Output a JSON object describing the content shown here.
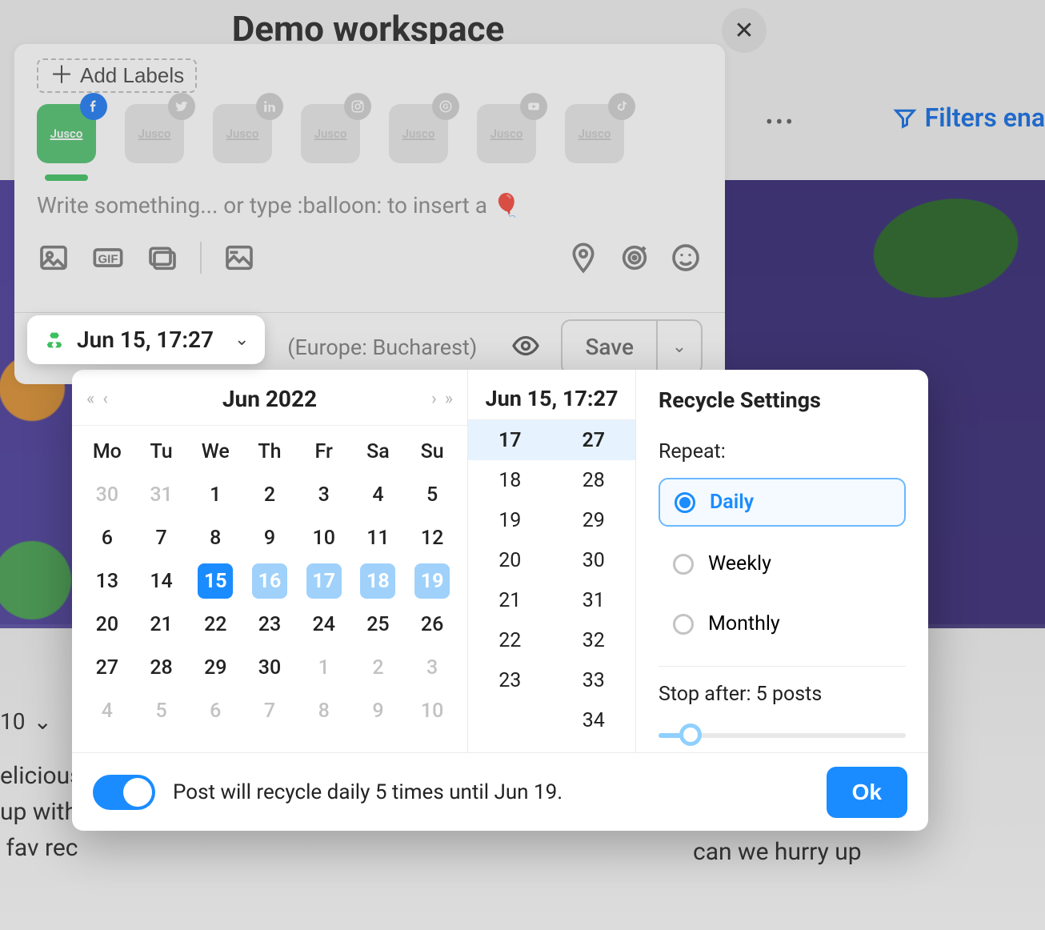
{
  "workspace": {
    "title": "Demo workspace"
  },
  "topbar": {
    "filters_label": "Filters ena"
  },
  "composer": {
    "add_labels": "Add Labels",
    "accounts": [
      {
        "brand": "Jusco",
        "network": "facebook",
        "active": true,
        "badge_color": "#1877f2"
      },
      {
        "brand": "Jusco",
        "network": "twitter",
        "active": false
      },
      {
        "brand": "Jusco",
        "network": "linkedin",
        "active": false
      },
      {
        "brand": "Jusco",
        "network": "instagram",
        "active": false
      },
      {
        "brand": "Jusco",
        "network": "google",
        "active": false
      },
      {
        "brand": "Jusco",
        "network": "youtube",
        "active": false
      },
      {
        "brand": "Jusco",
        "network": "tiktok",
        "active": false
      }
    ],
    "placeholder": "Write something... or type :balloon: to insert a 🎈",
    "timezone": "(Europe: Bucharest)",
    "save_label": "Save"
  },
  "schedule": {
    "date_pill": "Jun 15, 17:27",
    "calendar": {
      "title": "Jun  2022",
      "dow": [
        "Mo",
        "Tu",
        "We",
        "Th",
        "Fr",
        "Sa",
        "Su"
      ],
      "weeks": [
        [
          {
            "n": 30,
            "muted": true
          },
          {
            "n": 31,
            "muted": true
          },
          {
            "n": 1
          },
          {
            "n": 2
          },
          {
            "n": 3
          },
          {
            "n": 4
          },
          {
            "n": 5
          }
        ],
        [
          {
            "n": 6
          },
          {
            "n": 7
          },
          {
            "n": 8
          },
          {
            "n": 9
          },
          {
            "n": 10
          },
          {
            "n": 11
          },
          {
            "n": 12
          }
        ],
        [
          {
            "n": 13
          },
          {
            "n": 14
          },
          {
            "n": 15,
            "selected": true
          },
          {
            "n": 16,
            "range": true
          },
          {
            "n": 17,
            "range": true
          },
          {
            "n": 18,
            "range": true
          },
          {
            "n": 19,
            "range": true
          }
        ],
        [
          {
            "n": 20
          },
          {
            "n": 21
          },
          {
            "n": 22
          },
          {
            "n": 23
          },
          {
            "n": 24
          },
          {
            "n": 25
          },
          {
            "n": 26
          }
        ],
        [
          {
            "n": 27
          },
          {
            "n": 28
          },
          {
            "n": 29
          },
          {
            "n": 30
          },
          {
            "n": 1,
            "muted": true
          },
          {
            "n": 2,
            "muted": true
          },
          {
            "n": 3,
            "muted": true
          }
        ],
        [
          {
            "n": 4,
            "muted": true
          },
          {
            "n": 5,
            "muted": true
          },
          {
            "n": 6,
            "muted": true
          },
          {
            "n": 7,
            "muted": true
          },
          {
            "n": 8,
            "muted": true
          },
          {
            "n": 9,
            "muted": true
          },
          {
            "n": 10,
            "muted": true
          }
        ]
      ]
    },
    "time_header": "Jun 15, 17:27",
    "time_selected": {
      "hour": "17",
      "minute": "27"
    },
    "hours": [
      "17",
      "18",
      "19",
      "20",
      "21",
      "22",
      "23"
    ],
    "minutes": [
      "27",
      "28",
      "29",
      "30",
      "31",
      "32",
      "33",
      "34"
    ],
    "settings": {
      "title": "Recycle Settings",
      "repeat_label": "Repeat:",
      "options": [
        "Daily",
        "Weekly",
        "Monthly"
      ],
      "selected_option": "Daily",
      "stop_after_label": "Stop after: 5 posts",
      "stop_after_value": 5
    },
    "footer": {
      "summary": "Post will recycle daily 5 times until Jun 19.",
      "ok_label": "Ok",
      "toggle_on": true
    }
  },
  "background_text": {
    "select_value": "10",
    "left_fragment": "elicious\nup with\n fav rec",
    "right_fragment": "can we hurry up"
  }
}
